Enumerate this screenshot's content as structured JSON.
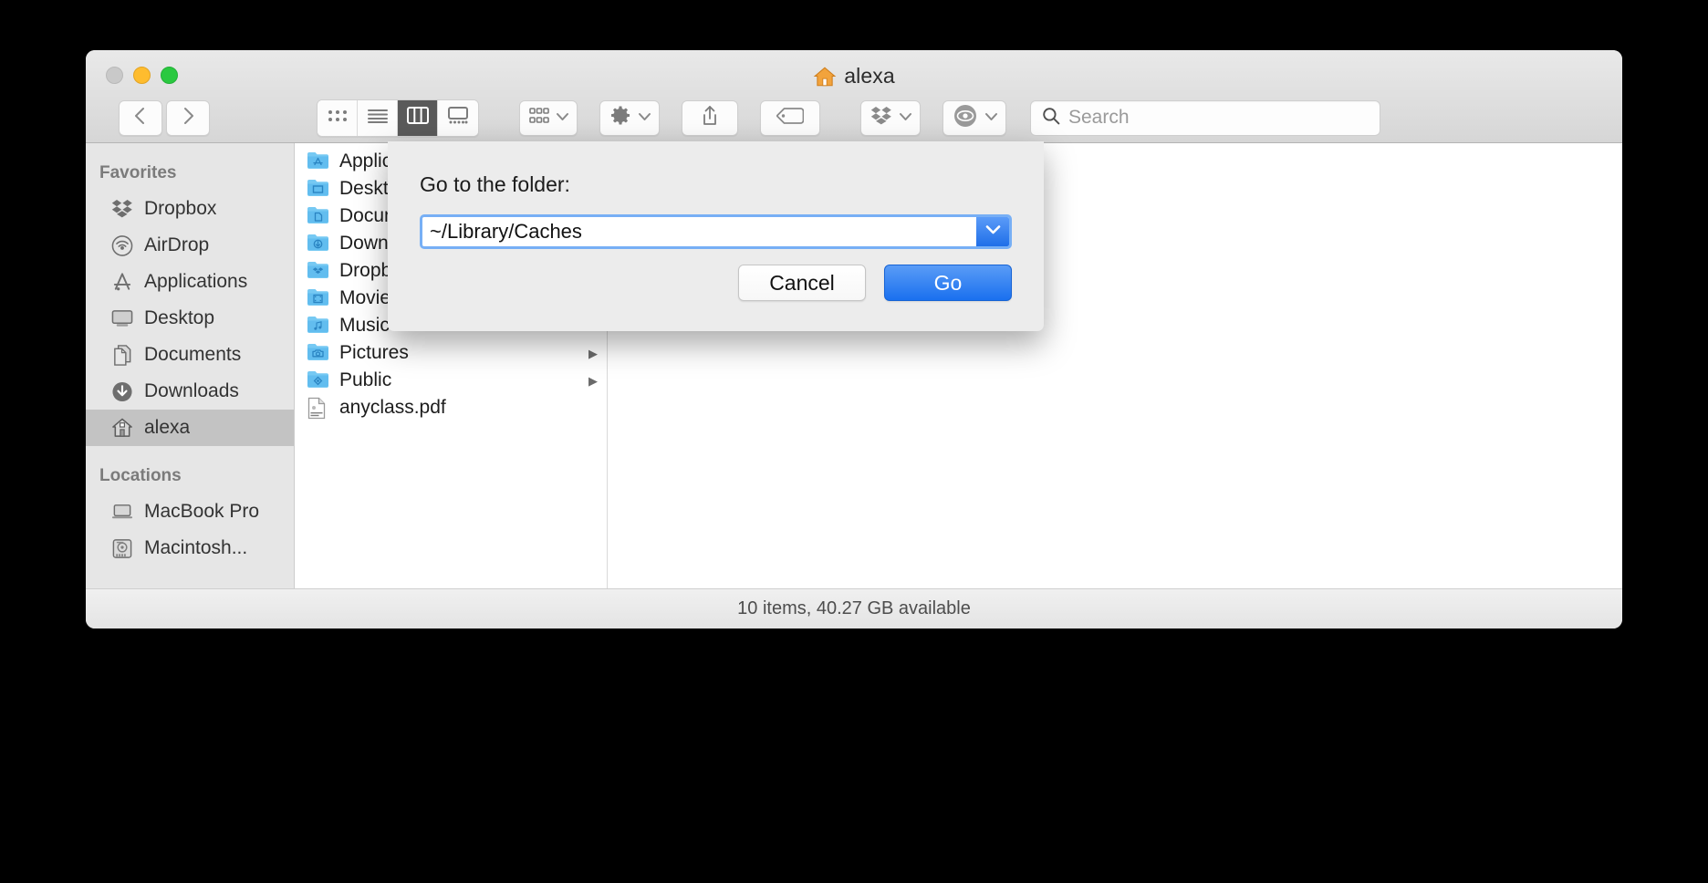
{
  "window": {
    "title": "alexa",
    "title_icon": "home-icon",
    "traffic_lights": [
      "close",
      "minimize",
      "maximize"
    ]
  },
  "toolbar": {
    "back_icon": "chevron-left-icon",
    "forward_icon": "chevron-right-icon",
    "view_modes": [
      {
        "name": "icon-view",
        "icon": "grid-icon",
        "active": false
      },
      {
        "name": "list-view",
        "icon": "list-icon",
        "active": false
      },
      {
        "name": "column-view",
        "icon": "columns-icon",
        "active": true
      },
      {
        "name": "gallery-view",
        "icon": "gallery-icon",
        "active": false
      }
    ],
    "group_button": {
      "name": "group-by",
      "icon": "grid-small-icon",
      "chevron": "chevron-down-icon"
    },
    "action_button": {
      "name": "action-menu",
      "icon": "gear-icon",
      "chevron": "chevron-down-icon"
    },
    "share_button": {
      "name": "share",
      "icon": "share-icon"
    },
    "tag_button": {
      "name": "edit-tags",
      "icon": "tag-icon"
    },
    "dropbox_button": {
      "name": "dropbox",
      "icon": "dropbox-icon",
      "chevron": "chevron-down-icon"
    },
    "preview_button": {
      "name": "preview-eye",
      "icon": "eye-icon",
      "chevron": "chevron-down-icon"
    }
  },
  "search": {
    "icon": "search-icon",
    "placeholder": "Search",
    "value": ""
  },
  "sidebar": {
    "sections": [
      {
        "title": "Favorites",
        "items": [
          {
            "label": "Dropbox",
            "icon": "dropbox-icon",
            "selected": false
          },
          {
            "label": "AirDrop",
            "icon": "airdrop-icon",
            "selected": false
          },
          {
            "label": "Applications",
            "icon": "applications-icon",
            "selected": false
          },
          {
            "label": "Desktop",
            "icon": "desktop-icon",
            "selected": false
          },
          {
            "label": "Documents",
            "icon": "documents-icon",
            "selected": false
          },
          {
            "label": "Downloads",
            "icon": "downloads-icon",
            "selected": false
          },
          {
            "label": "alexa",
            "icon": "home-icon",
            "selected": true
          }
        ]
      },
      {
        "title": "Locations",
        "items": [
          {
            "label": "MacBook Pro",
            "icon": "laptop-icon",
            "selected": false
          },
          {
            "label": "Macintosh...",
            "icon": "harddisk-icon",
            "selected": false
          }
        ]
      }
    ]
  },
  "file_column": {
    "items": [
      {
        "name": "Applications",
        "icon": "folder-applications-icon",
        "has_children": false
      },
      {
        "name": "Desktop",
        "icon": "folder-desktop-icon",
        "has_children": false
      },
      {
        "name": "Documents",
        "icon": "folder-documents-icon",
        "has_children": false
      },
      {
        "name": "Downloads",
        "icon": "folder-downloads-icon",
        "has_children": false
      },
      {
        "name": "Dropbox",
        "icon": "folder-dropbox-icon",
        "has_children": false
      },
      {
        "name": "Movies",
        "icon": "folder-movies-icon",
        "has_children": false
      },
      {
        "name": "Music",
        "icon": "folder-music-icon",
        "has_children": false
      },
      {
        "name": "Pictures",
        "icon": "folder-pictures-icon",
        "has_children": true
      },
      {
        "name": "Public",
        "icon": "folder-public-icon",
        "has_children": true
      },
      {
        "name": "anyclass.pdf",
        "icon": "pdf-file-icon",
        "has_children": false
      }
    ]
  },
  "status_bar": {
    "text": "10 items, 40.27 GB available"
  },
  "sheet": {
    "label": "Go to the folder:",
    "input_value": "~/Library/Caches",
    "dropdown_icon": "chevron-down-icon",
    "cancel_label": "Cancel",
    "go_label": "Go"
  },
  "colors": {
    "accent_blue": "#1a70ef",
    "focus_ring": "#77aff5",
    "folder_blue": "#6cc5f5",
    "selected_sidebar": "#c3c3c3",
    "traffic_close": "#c9c9c9",
    "traffic_min": "#febc2e",
    "traffic_max": "#2ac940"
  }
}
